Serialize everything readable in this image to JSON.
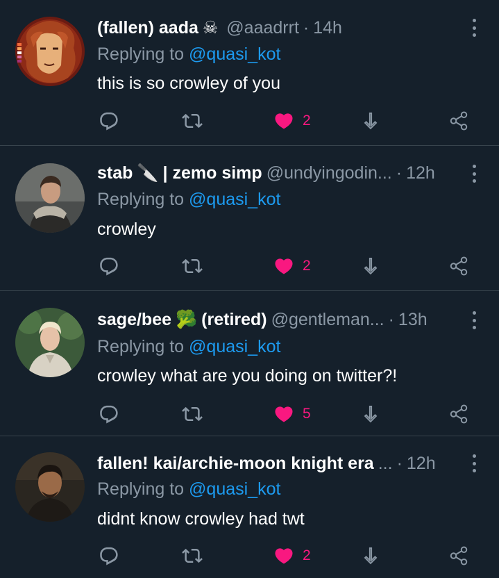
{
  "colors": {
    "background": "#15202b",
    "divider": "#38444d",
    "secondary_text": "#8b98a5",
    "mention": "#1d9bf0",
    "like": "#f91880"
  },
  "tweets": [
    {
      "display_name": "(fallen) aada",
      "name_emoji": "☠",
      "handle": "@aaadrrt",
      "time": "14h",
      "replying_prefix": "Replying to",
      "replying_mention": "@quasi_kot",
      "text": "this is so crowley of you",
      "likes": "2",
      "liked": true
    },
    {
      "display_name": "stab",
      "name_emoji": "🔪",
      "display_name_suffix": "| zemo simp",
      "handle": "@undyingodin...",
      "time": "12h",
      "replying_prefix": "Replying to",
      "replying_mention": "@quasi_kot",
      "text": "crowley",
      "likes": "2",
      "liked": true
    },
    {
      "display_name": "sage/bee",
      "name_emoji": "🥦",
      "display_name_suffix": "(retired)",
      "handle": "@gentleman...",
      "time": "13h",
      "replying_prefix": "Replying to",
      "replying_mention": "@quasi_kot",
      "text": "crowley what are you doing on twitter?!",
      "likes": "5",
      "liked": true
    },
    {
      "display_name": "fallen! kai/archie-moon knight era",
      "handle_truncated": "...",
      "time": "12h",
      "replying_prefix": "Replying to",
      "replying_mention": "@quasi_kot",
      "text": "didnt know crowley had twt",
      "likes": "2",
      "liked": true
    }
  ],
  "icons": {
    "reply": "reply-bubble-icon",
    "retweet": "retweet-icon",
    "like": "heart-icon",
    "share": "share-arrow-down-icon",
    "more": "more-vertical-icon",
    "share_network": "share-network-icon"
  }
}
